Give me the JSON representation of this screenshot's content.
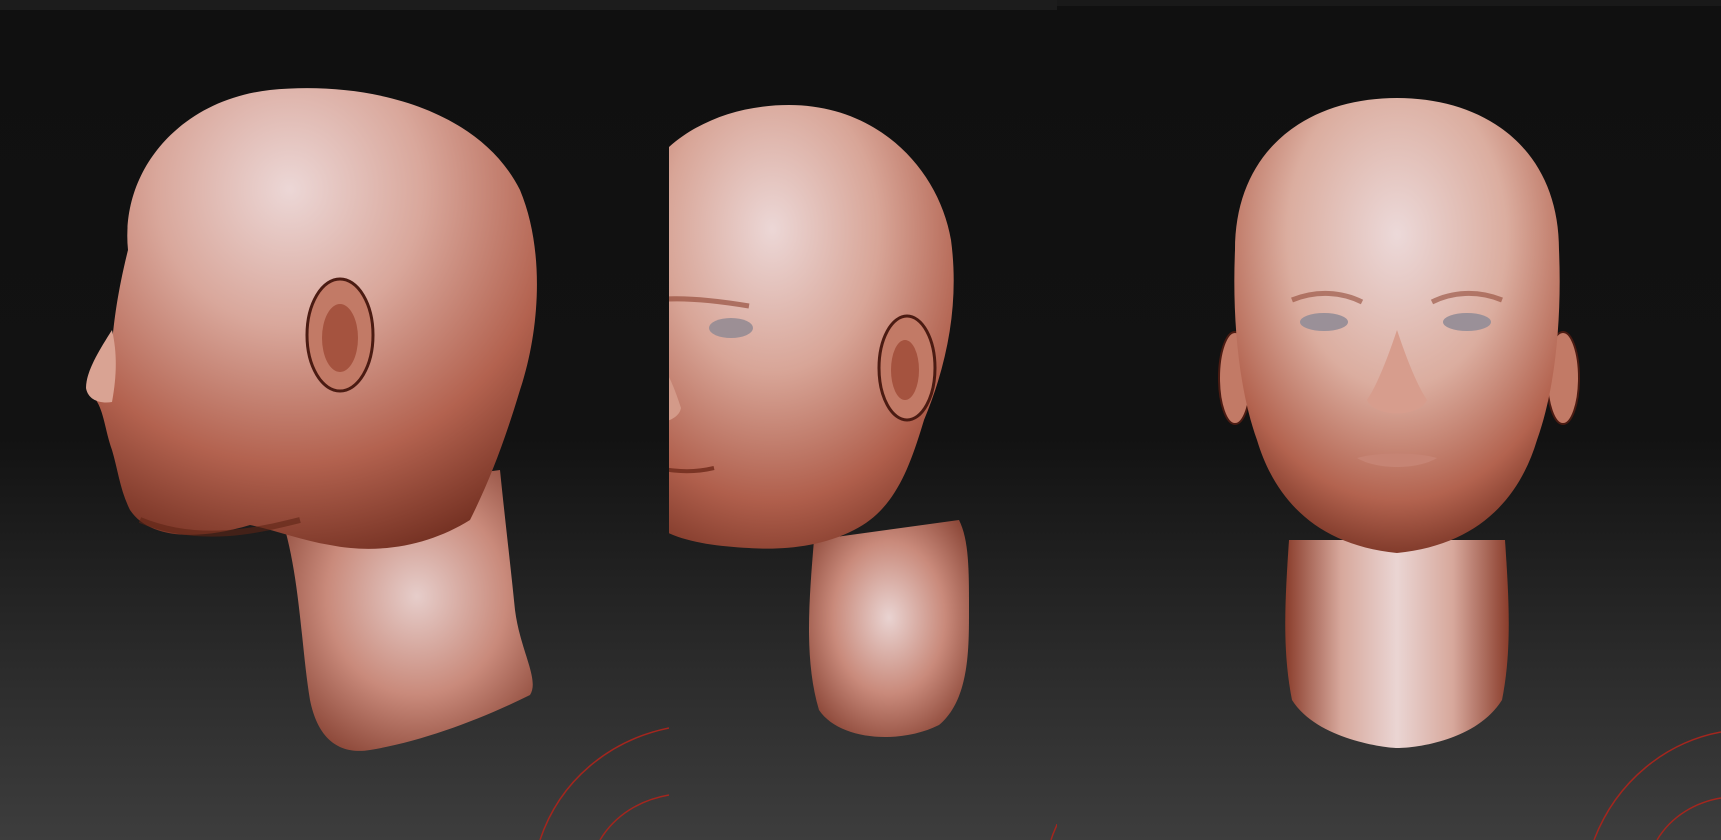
{
  "scene": {
    "description_tags": [
      "sculpt-viewport",
      "head-model"
    ],
    "colors": {
      "background_top": "#101010",
      "background_bottom": "#3d3d3d",
      "clay_light": "#e9d2d0",
      "clay_mid": "#c47a68",
      "clay_dark": "#7a3424",
      "gizmo_red": "#a3261e"
    },
    "views": [
      {
        "view": "side",
        "icon": "head-profile-render"
      },
      {
        "view": "three-quarter",
        "icon": "head-three-quarter-render"
      },
      {
        "view": "front",
        "icon": "head-front-render"
      }
    ]
  }
}
